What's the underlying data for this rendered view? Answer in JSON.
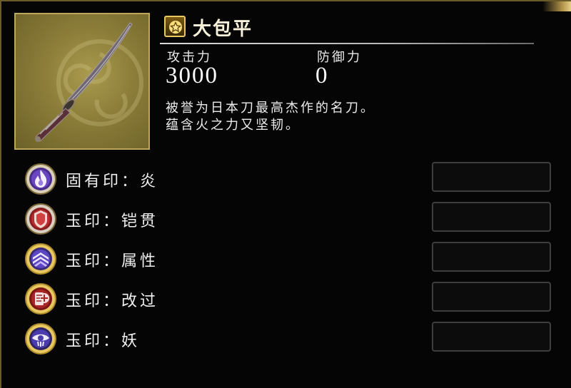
{
  "item": {
    "name": "大包平",
    "rank_icon": "gold-rank-star-icon",
    "portrait_icon": "katana-icon"
  },
  "stats": {
    "attack_label": "攻击力",
    "attack_value": "3000",
    "defense_label": "防御力",
    "defense_value": "0"
  },
  "description": {
    "line1": "被誉为日本刀最高杰作的名刀。",
    "line2": "蕴含火之力又坚韧。"
  },
  "seals": [
    {
      "label": "固有印：炎",
      "icon": "fire-seal-icon"
    },
    {
      "label": "玉印：铠贯",
      "icon": "armor-pierce-seal-icon"
    },
    {
      "label": "玉印：属性",
      "icon": "attribute-seal-icon"
    },
    {
      "label": "玉印：改过",
      "icon": "reform-seal-icon"
    },
    {
      "label": "玉印：妖",
      "icon": "yokai-eye-seal-icon"
    }
  ],
  "colors": {
    "gold_accent": "#e8c861",
    "panel_bg": "#050505",
    "slot_border": "#3e3e3e"
  }
}
